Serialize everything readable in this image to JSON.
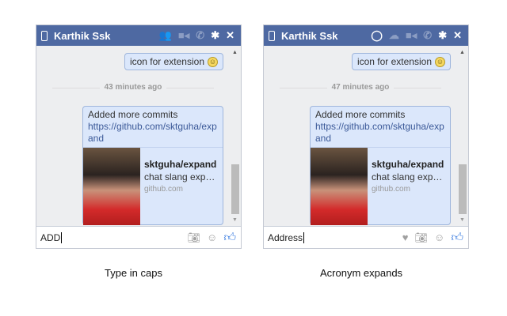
{
  "windows": [
    {
      "contact": "Karthik Ssk",
      "msg1": "icon for extension",
      "time": "43 minutes ago",
      "msg2_line1": "Added more commits",
      "msg2_link": "https://github.com/sktguha/expand",
      "card_title": "sktguha/expand",
      "card_desc": "chat slang exp…",
      "card_site": "github.com",
      "input_value": "ADD",
      "caption": "Type in caps"
    },
    {
      "contact": "Karthik Ssk",
      "msg1": "icon for extension",
      "time": "47 minutes ago",
      "msg2_line1": "Added more commits",
      "msg2_link": "https://github.com/sktguha/expand",
      "card_title": "sktguha/expand",
      "card_desc": "chat slang exp…",
      "card_site": "github.com",
      "input_value": "Address",
      "caption": "Acronym expands"
    }
  ],
  "colors": {
    "header": "#4e69a2",
    "bubble": "#dbe7fb",
    "like": "#3b7de0"
  }
}
